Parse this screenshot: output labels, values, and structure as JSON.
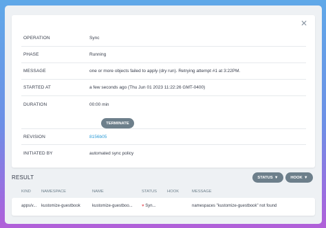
{
  "close_icon": "close-icon",
  "details": {
    "operation": {
      "label": "OPERATION",
      "value": "Sync"
    },
    "phase": {
      "label": "PHASE",
      "value": "Running"
    },
    "message": {
      "label": "MESSAGE",
      "value": "one or more objects failed to apply (dry run). Retrying attempt #1 at 3:22PM."
    },
    "started_at": {
      "label": "STARTED AT",
      "value": "a few seconds ago (Thu Jun 01 2023 11:22:26 GMT-0400)"
    },
    "duration": {
      "label": "DURATION",
      "value": "00:00 min"
    },
    "terminate_label": "TERMINATE",
    "revision": {
      "label": "REVISION",
      "value": "8156b05"
    },
    "initiated_by": {
      "label": "INITIATED BY",
      "value": "automated sync policy"
    }
  },
  "result": {
    "title": "RESULT",
    "status_button": "STATUS",
    "hook_button": "HOOK",
    "columns": [
      "KIND",
      "NAMESPACE",
      "NAME",
      "STATUS",
      "HOOK",
      "MESSAGE"
    ],
    "rows": [
      {
        "kind": "apps/v...",
        "namespace": "kustomize-guestbook",
        "name": "kustomize-guestboo...",
        "status": "Syn...",
        "hook": "",
        "message": "namespaces \"kustomize-guestbook\" not found"
      }
    ]
  },
  "colors": {
    "button_bg": "#6d7f8b",
    "link": "#2a9ad6",
    "status_heart": "#e96d76"
  }
}
